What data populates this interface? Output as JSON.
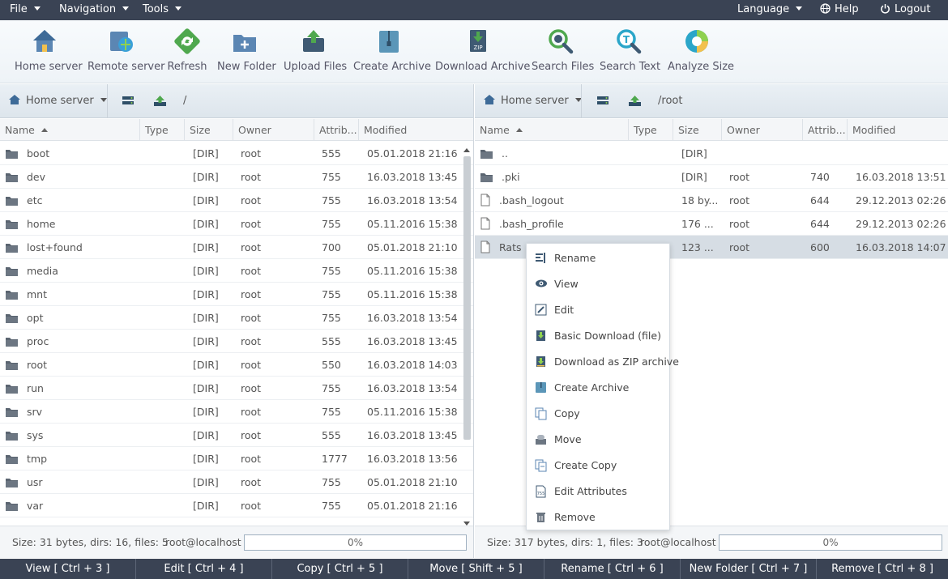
{
  "menubar": {
    "file": "File",
    "navigation": "Navigation",
    "tools": "Tools",
    "language": "Language",
    "help": "Help",
    "logout": "Logout"
  },
  "toolbar": {
    "home_server": "Home server",
    "remote_server": "Remote server",
    "refresh": "Refresh",
    "new_folder": "New Folder",
    "upload_files": "Upload Files",
    "create_archive": "Create Archive",
    "download_archive": "Download Archive",
    "search_files": "Search Files",
    "search_text": "Search Text",
    "analyze_size": "Analyze Size"
  },
  "left_panel": {
    "server": "Home server",
    "path": "/",
    "columns": {
      "name": "Name",
      "type": "Type",
      "size": "Size",
      "owner": "Owner",
      "attrib": "Attrib...",
      "modified": "Modified"
    },
    "rows": [
      {
        "name": "boot",
        "size": "[DIR]",
        "owner": "root",
        "attrib": "555",
        "modified": "05.01.2018 21:16..."
      },
      {
        "name": "dev",
        "size": "[DIR]",
        "owner": "root",
        "attrib": "755",
        "modified": "16.03.2018 13:45..."
      },
      {
        "name": "etc",
        "size": "[DIR]",
        "owner": "root",
        "attrib": "755",
        "modified": "16.03.2018 13:54..."
      },
      {
        "name": "home",
        "size": "[DIR]",
        "owner": "root",
        "attrib": "755",
        "modified": "05.11.2016 15:38..."
      },
      {
        "name": "lost+found",
        "size": "[DIR]",
        "owner": "root",
        "attrib": "700",
        "modified": "05.01.2018 21:10..."
      },
      {
        "name": "media",
        "size": "[DIR]",
        "owner": "root",
        "attrib": "755",
        "modified": "05.11.2016 15:38..."
      },
      {
        "name": "mnt",
        "size": "[DIR]",
        "owner": "root",
        "attrib": "755",
        "modified": "05.11.2016 15:38..."
      },
      {
        "name": "opt",
        "size": "[DIR]",
        "owner": "root",
        "attrib": "755",
        "modified": "16.03.2018 13:54..."
      },
      {
        "name": "proc",
        "size": "[DIR]",
        "owner": "root",
        "attrib": "555",
        "modified": "16.03.2018 13:45..."
      },
      {
        "name": "root",
        "size": "[DIR]",
        "owner": "root",
        "attrib": "550",
        "modified": "16.03.2018 14:03..."
      },
      {
        "name": "run",
        "size": "[DIR]",
        "owner": "root",
        "attrib": "755",
        "modified": "16.03.2018 13:54..."
      },
      {
        "name": "srv",
        "size": "[DIR]",
        "owner": "root",
        "attrib": "755",
        "modified": "05.11.2016 15:38..."
      },
      {
        "name": "sys",
        "size": "[DIR]",
        "owner": "root",
        "attrib": "555",
        "modified": "16.03.2018 13:45..."
      },
      {
        "name": "tmp",
        "size": "[DIR]",
        "owner": "root",
        "attrib": "1777",
        "modified": "16.03.2018 13:56..."
      },
      {
        "name": "usr",
        "size": "[DIR]",
        "owner": "root",
        "attrib": "755",
        "modified": "05.01.2018 21:10..."
      },
      {
        "name": "var",
        "size": "[DIR]",
        "owner": "root",
        "attrib": "755",
        "modified": "05.01.2018 21:16..."
      }
    ],
    "status": {
      "summary": "Size: 31 bytes, dirs: 16, files: 5",
      "user": "root@localhost",
      "progress": "0%"
    }
  },
  "right_panel": {
    "server": "Home server",
    "path": "/root",
    "columns": {
      "name": "Name",
      "type": "Type",
      "size": "Size",
      "owner": "Owner",
      "attrib": "Attrib...",
      "modified": "Modified"
    },
    "rows": [
      {
        "name": "..",
        "icon": "folder-icon",
        "size": "[DIR]",
        "owner": "",
        "attrib": "",
        "modified": ""
      },
      {
        "name": ".pki",
        "icon": "folder-icon",
        "size": "[DIR]",
        "owner": "root",
        "attrib": "740",
        "modified": "16.03.2018 13:51..."
      },
      {
        "name": ".bash_logout",
        "icon": "file-icon",
        "size": "18 by...",
        "owner": "root",
        "attrib": "644",
        "modified": "29.12.2013 02:26..."
      },
      {
        "name": ".bash_profile",
        "icon": "file-icon",
        "size": "176 ...",
        "owner": "root",
        "attrib": "644",
        "modified": "29.12.2013 02:26..."
      },
      {
        "name": "Rats",
        "icon": "file-icon",
        "size": "123 ...",
        "owner": "root",
        "attrib": "600",
        "modified": "16.03.2018 14:07...",
        "selected": true
      }
    ],
    "status": {
      "summary": "Size: 317 bytes, dirs: 1, files: 3",
      "user": "root@localhost",
      "progress": "0%"
    }
  },
  "context_menu": {
    "items": [
      {
        "label": "Rename",
        "icon": "rename-icon"
      },
      {
        "label": "View",
        "icon": "eye-icon"
      },
      {
        "label": "Edit",
        "icon": "edit-icon"
      },
      {
        "label": "Basic Download (file)",
        "icon": "download-icon"
      },
      {
        "label": "Download as ZIP archive",
        "icon": "zip-download-icon"
      },
      {
        "label": "Create Archive",
        "icon": "archive-icon"
      },
      {
        "label": "Copy",
        "icon": "copy-icon"
      },
      {
        "label": "Move",
        "icon": "move-icon"
      },
      {
        "label": "Create Copy",
        "icon": "create-copy-icon"
      },
      {
        "label": "Edit Attributes",
        "icon": "attributes-icon"
      },
      {
        "label": "Remove",
        "icon": "trash-icon"
      }
    ]
  },
  "fkeys": [
    "View [ Ctrl + 3 ]",
    "Edit [ Ctrl + 4 ]",
    "Copy [ Ctrl + 5 ]",
    "Move [ Shift + 5 ]",
    "Rename [ Ctrl + 6 ]",
    "New Folder [ Ctrl + 7 ]",
    "Remove [ Ctrl + 8 ]"
  ],
  "colors": {
    "dark_bar": "#3a4354",
    "selected_row": "#d6dde4",
    "toolbar_bg": "#eef3f7"
  }
}
